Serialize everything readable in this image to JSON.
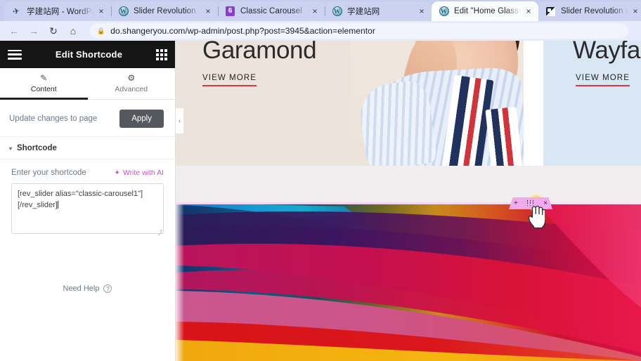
{
  "browser": {
    "tabs": [
      {
        "title": "学建站网 - WordPre",
        "favicon": "plane-icon",
        "active": false,
        "close_label": "×"
      },
      {
        "title": "Slider Revolution -",
        "favicon": "wordpress-icon",
        "active": false,
        "close_label": "×"
      },
      {
        "title": "Classic Carousel - S",
        "favicon": "number-six-icon",
        "active": false,
        "close_label": "×"
      },
      {
        "title": "学建站网",
        "favicon": "wordpress-icon",
        "active": false,
        "close_label": "×"
      },
      {
        "title": "Edit \"Home Glasses",
        "favicon": "wordpress-icon",
        "active": true,
        "close_label": "×"
      },
      {
        "title": "Slider Revolution R",
        "favicon": "slider-revolution-icon",
        "active": false,
        "close_label": "×"
      }
    ],
    "nav": {
      "back": "←",
      "forward": "→",
      "reload": "↻",
      "home": "⌂"
    },
    "omnibox": {
      "lock_icon": "lock-icon",
      "url": "do.shangeryou.com/wp-admin/post.php?post=3945&action=elementor"
    }
  },
  "panel": {
    "header": {
      "menu_icon": "hamburger-menu-icon",
      "title": "Edit Shortcode",
      "apps_icon": "widgets-grid-icon"
    },
    "tabs": [
      {
        "label": "Content",
        "icon": "pencil-icon",
        "selected": true
      },
      {
        "label": "Advanced",
        "icon": "gear-icon",
        "selected": false
      }
    ],
    "update_row": {
      "label": "Update changes to page",
      "apply_label": "Apply"
    },
    "section": {
      "caret": "▾",
      "title": "Shortcode"
    },
    "field": {
      "label": "Enter your shortcode",
      "ai_label": "Write with AI",
      "ai_icon": "sparkle-icon",
      "value_line1": "[rev_slider alias=\"classic-carousel1\"]",
      "value_line2": "[/rev_slider]",
      "placeholder": ""
    },
    "footer": {
      "need_help": "Need Help",
      "help_icon": "question-circle-icon"
    }
  },
  "canvas": {
    "slides": [
      {
        "title": "Garamond",
        "cta": "VIEW MORE",
        "bg": "#ece4dc"
      },
      {
        "title": "Wayfare",
        "cta": "VIEW MORE",
        "bg": "#d9e7f5"
      }
    ],
    "widget_toolbar": {
      "add_label": "+",
      "drag_icon": "drag-handle-icon",
      "close_label": "×"
    },
    "slider_prev": "‹",
    "cursor": "pointer-hand-cursor"
  },
  "colors": {
    "browser_chrome": "#c6cdee",
    "toolbar_bg": "#e7eafb",
    "panel_header_bg": "#151515",
    "apply_button_bg": "#55595f",
    "ai_accent": "#c850c8",
    "cta_underline": "#e2353b",
    "widget_toolbar_bg": "#f3a9ee",
    "click_glow": "#ffd640"
  }
}
